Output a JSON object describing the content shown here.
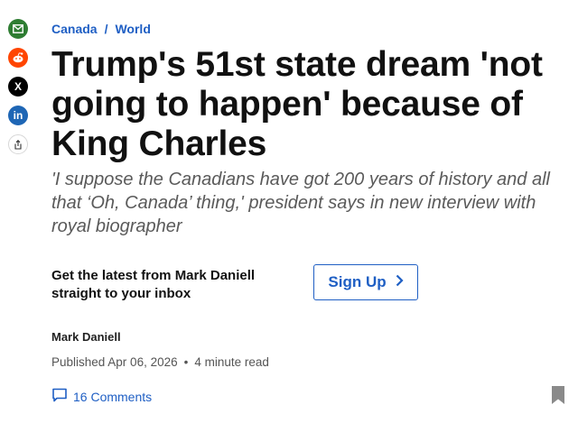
{
  "share": {
    "email_icon": "email-icon",
    "reddit_icon": "reddit-icon",
    "x_label": "X",
    "linkedin_label": "in",
    "share_icon": "share-icon"
  },
  "breadcrumb": {
    "items": [
      "Canada",
      "World"
    ],
    "separator": "/"
  },
  "article": {
    "headline": "Trump's 51st state dream 'not going to happen' because of King Charles",
    "dek": "'I suppose the Canadians have got 200 years of history and all that ‘Oh, Canada’ thing,' president says in new interview with royal biographer"
  },
  "newsletter": {
    "text": "Get the latest from Mark Daniell straight to your inbox",
    "button_label": "Sign Up",
    "button_icon": "chevron-right-icon"
  },
  "byline": {
    "author": "Mark Daniell",
    "published": "Published Apr 06, 2026",
    "separator": "•",
    "read_time": "4 minute read"
  },
  "comments": {
    "label": "16 Comments",
    "icon": "comment-icon"
  },
  "bookmark": {
    "icon": "bookmark-icon"
  },
  "colors": {
    "link": "#1f5fc4",
    "email": "#2e7d32",
    "reddit": "#ff4500",
    "x": "#000000",
    "linkedin": "#1e66b5"
  }
}
